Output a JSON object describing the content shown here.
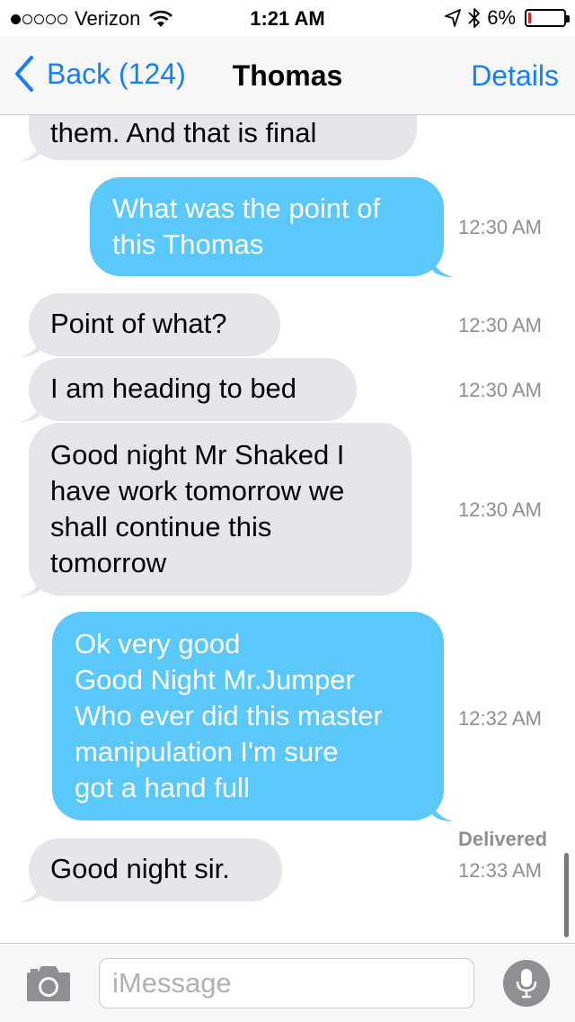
{
  "status_bar": {
    "carrier": "Verizon",
    "signal_bars_filled": 1,
    "signal_bars_total": 5,
    "time": "1:21 AM",
    "battery_percent": "6%",
    "battery_level": 0.06,
    "battery_color": "#e02020"
  },
  "nav": {
    "back_label": "Back (124)",
    "title": "Thomas",
    "details_label": "Details",
    "accent_color": "#157efb"
  },
  "messages": [
    {
      "direction": "incoming",
      "text": "them.  And that is final",
      "time": ""
    },
    {
      "direction": "outgoing",
      "text": "What was the point of\nthis Thomas",
      "time": "12:30 AM"
    },
    {
      "direction": "incoming",
      "text": "Point of what?",
      "time": "12:30 AM"
    },
    {
      "direction": "incoming",
      "text": "I am heading to bed",
      "time": "12:30 AM"
    },
    {
      "direction": "incoming",
      "text": "Good night Mr Shaked I\nhave work tomorrow we\nshall continue this\ntomorrow",
      "time": "12:30 AM"
    },
    {
      "direction": "outgoing",
      "text": "Ok very good\nGood Night Mr.Jumper\nWho ever did this master\nmanipulation I'm sure\ngot a hand full",
      "time": "12:32 AM"
    },
    {
      "direction": "incoming",
      "text": "Good night sir.",
      "time": "12:33 AM"
    }
  ],
  "delivered_label": "Delivered",
  "colors": {
    "incoming_bubble": "#e5e5ea",
    "outgoing_bubble": "#5ac8fa"
  },
  "input_bar": {
    "placeholder": "iMessage",
    "camera_icon": "camera-icon",
    "mic_icon": "microphone-icon"
  }
}
